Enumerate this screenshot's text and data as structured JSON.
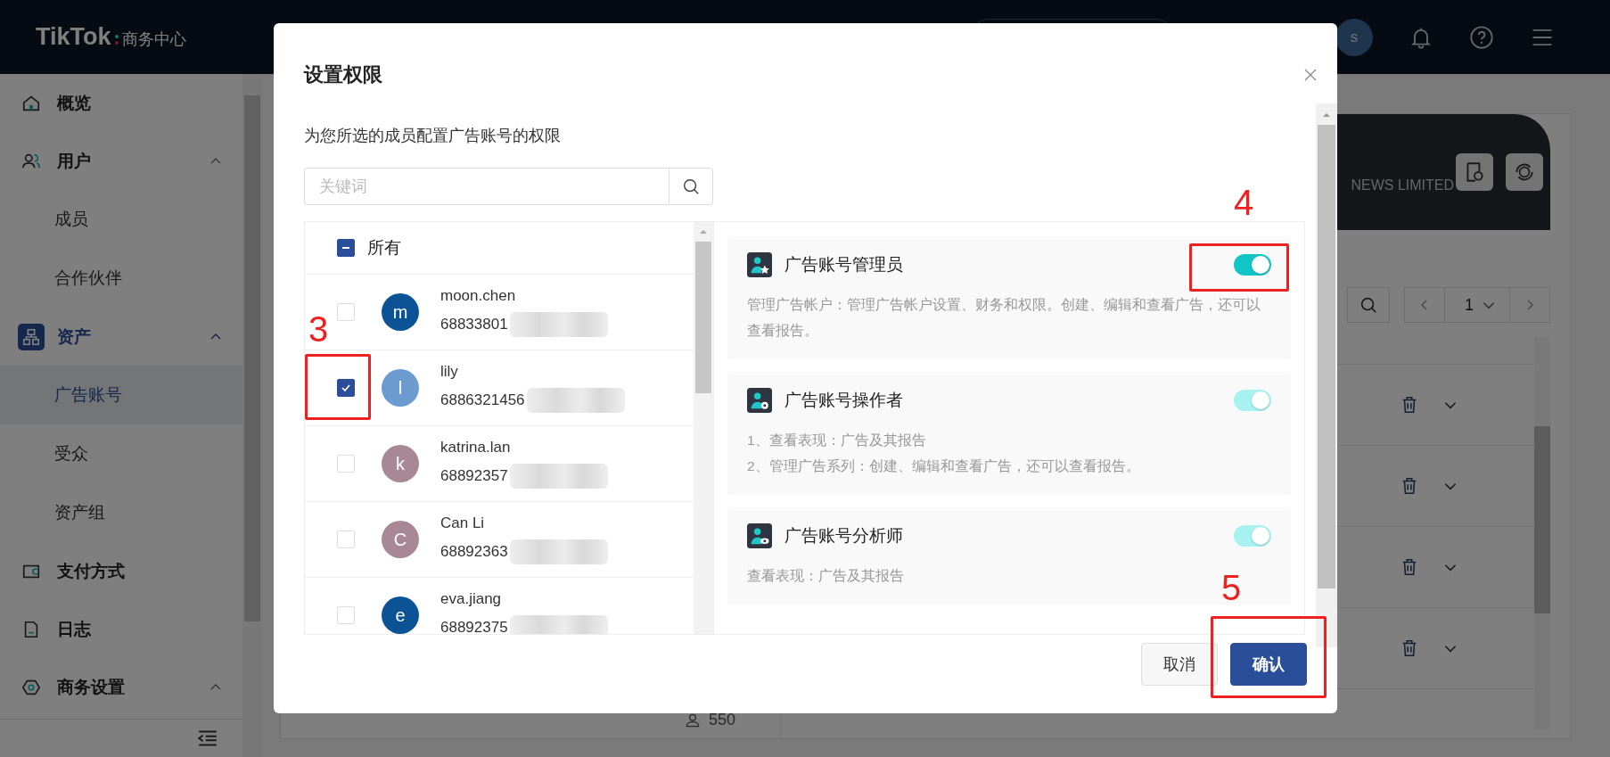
{
  "header": {
    "logo": "TikTok",
    "logo_suffix": "商务中心",
    "avatar": "s"
  },
  "sidebar": {
    "items": [
      {
        "label": "概览",
        "selected": false
      },
      {
        "label": "用户",
        "selected": false,
        "expanded": true,
        "children": [
          {
            "label": "成员",
            "selected": false
          },
          {
            "label": "合作伙伴",
            "selected": false
          }
        ]
      },
      {
        "label": "资产",
        "selected": true,
        "expanded": true,
        "children": [
          {
            "label": "广告账号",
            "selected": true
          },
          {
            "label": "受众",
            "selected": false
          },
          {
            "label": "资产组",
            "selected": false
          }
        ]
      },
      {
        "label": "支付方式",
        "selected": false
      },
      {
        "label": "日志",
        "selected": false
      },
      {
        "label": "商务设置",
        "selected": false,
        "expanded": true
      }
    ]
  },
  "main": {
    "banner_text": "NEWS LIMITED",
    "page": "1",
    "count": "550"
  },
  "modal": {
    "title": "设置权限",
    "subtitle": "为您所选的成员配置广告账号的权限",
    "search": {
      "placeholder": "关键词"
    },
    "select_all": {
      "label": "所有",
      "indeterminate": true
    },
    "members": [
      {
        "name": "moon.chen",
        "id": "68833801",
        "avatar": "m",
        "color": "#0b5394",
        "checked": false
      },
      {
        "name": "lily",
        "id": "6886321456",
        "avatar": "l",
        "color": "#6b9bcf",
        "checked": true,
        "annotation": "3"
      },
      {
        "name": "katrina.lan",
        "id": "68892357",
        "avatar": "k",
        "color": "#a88894",
        "checked": false
      },
      {
        "name": "Can Li",
        "id": "68892363",
        "avatar": "C",
        "color": "#a88894",
        "checked": false
      },
      {
        "name": "eva.jiang",
        "id": "68892375",
        "avatar": "e",
        "color": "#0b5394",
        "checked": false
      }
    ],
    "roles": [
      {
        "title": "广告账号管理员",
        "description": [
          "管理广告帐户：管理广告帐户设置、财务和权限。创建、编辑和查看广告，还可以查看报告。"
        ],
        "on": true,
        "disabled": false,
        "annotation": "4"
      },
      {
        "title": "广告账号操作者",
        "description": [
          "1、查看表现：广告及其报告",
          "2、管理广告系列：创建、编辑和查看广告，还可以查看报告。"
        ],
        "on": true,
        "disabled": true
      },
      {
        "title": "广告账号分析师",
        "description": [
          "查看表现：广告及其报告"
        ],
        "on": true,
        "disabled": true
      }
    ],
    "buttons": [
      {
        "label": "取消",
        "kind": "secondary"
      },
      {
        "label": "确认",
        "kind": "primary",
        "annotation": "5"
      }
    ]
  }
}
